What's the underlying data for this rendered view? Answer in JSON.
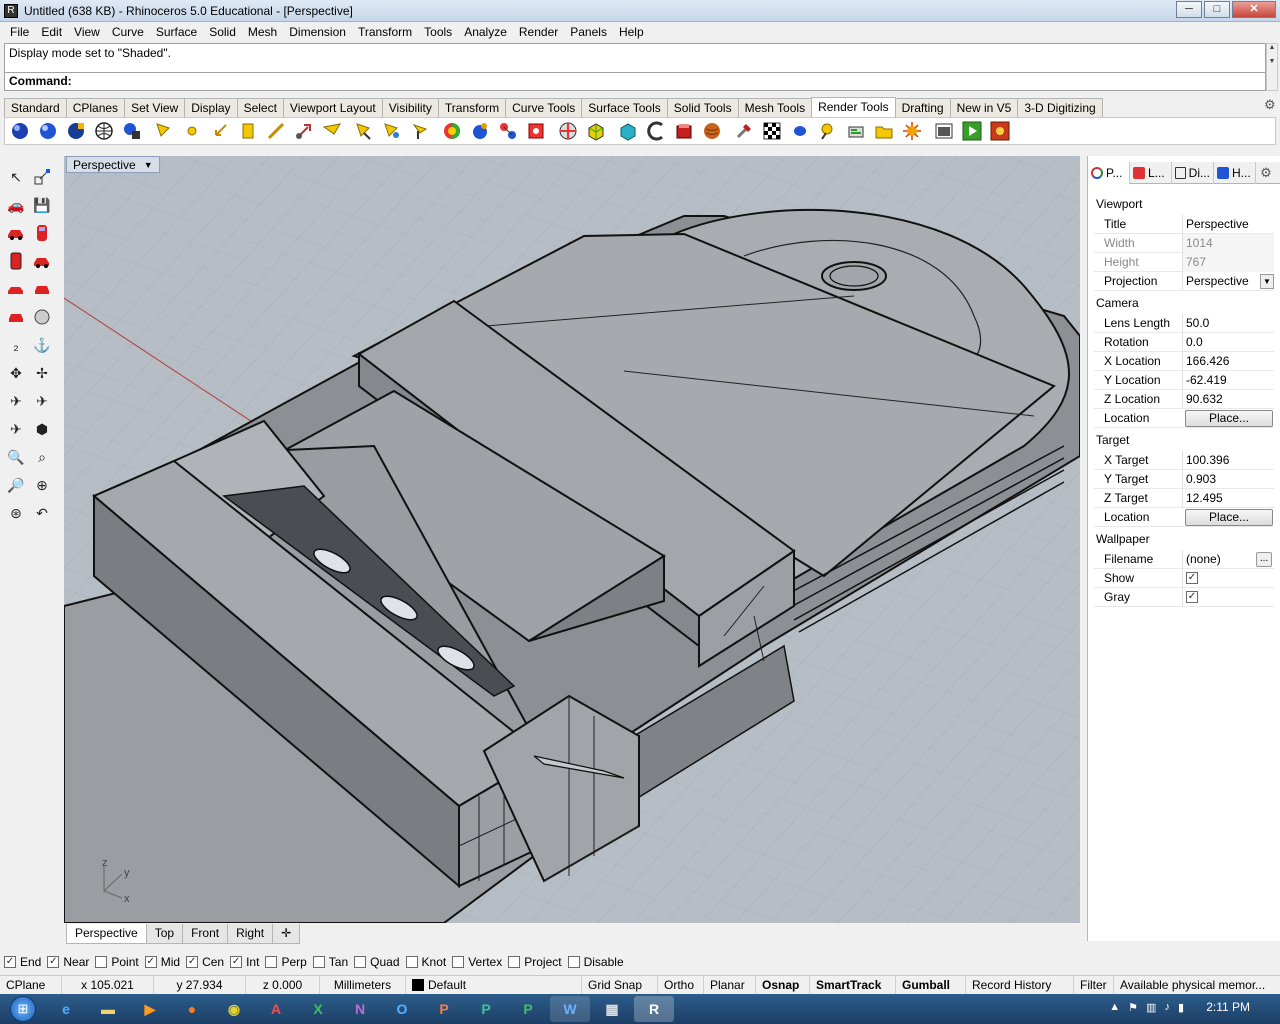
{
  "window": {
    "title": "Untitled (638 KB) - Rhinoceros 5.0 Educational - [Perspective]",
    "minimize": "─",
    "maximize": "□",
    "close": "✕"
  },
  "menu": [
    "File",
    "Edit",
    "View",
    "Curve",
    "Surface",
    "Solid",
    "Mesh",
    "Dimension",
    "Transform",
    "Tools",
    "Analyze",
    "Render",
    "Panels",
    "Help"
  ],
  "command": {
    "history": "Display mode set to \"Shaded\".",
    "prompt": "Command:"
  },
  "toolbar_tabs": [
    "Standard",
    "CPlanes",
    "Set View",
    "Display",
    "Select",
    "Viewport Layout",
    "Visibility",
    "Transform",
    "Curve Tools",
    "Surface Tools",
    "Solid Tools",
    "Mesh Tools",
    "Render Tools",
    "Drafting",
    "New in V5",
    "3-D Digitizing"
  ],
  "toolbar_active_tab": "Render Tools",
  "toolbar_icons": [
    "render-sphere-icon",
    "render-preview-icon",
    "render-blue-icon",
    "render-mesh-icon",
    "render-settings-icon",
    "spotlight-icon",
    "point-light-icon",
    "directional-light-icon",
    "rectangular-light-icon",
    "linear-light-icon",
    "light-array-icon",
    "sun-icon",
    "light-edit-icon",
    "light-target-icon",
    "material-editor-icon",
    "material-assign-icon",
    "texture-icon",
    "texture-apply-icon",
    "environment-icon",
    "ground-plane-icon",
    "decal-icon",
    "mapping-icon",
    "sphere-map-icon",
    "box-map-icon",
    "wood-texture-icon",
    "checker-icon",
    "dot-icon",
    "matchtool-icon",
    "snapshot-icon",
    "folder-icon",
    "sun-settings-icon",
    "render-window-icon",
    "play-icon",
    "record-icon"
  ],
  "viewport": {
    "title": "Perspective",
    "tabs": [
      "Perspective",
      "Top",
      "Front",
      "Right"
    ],
    "active_tab": "Perspective",
    "axis_z": "z",
    "axis_y": "y",
    "axis_x": "x"
  },
  "panel": {
    "tabs": [
      "P...",
      "L...",
      "Di...",
      "H..."
    ],
    "sections": {
      "viewport": "Viewport",
      "camera": "Camera",
      "target": "Target",
      "wallpaper": "Wallpaper"
    },
    "rows": {
      "title": {
        "label": "Title",
        "value": "Perspective"
      },
      "width": {
        "label": "Width",
        "value": "1014"
      },
      "height": {
        "label": "Height",
        "value": "767"
      },
      "projection": {
        "label": "Projection",
        "value": "Perspective"
      },
      "lens_length": {
        "label": "Lens Length",
        "value": "50.0"
      },
      "rotation": {
        "label": "Rotation",
        "value": "0.0"
      },
      "x_location": {
        "label": "X Location",
        "value": "166.426"
      },
      "y_location": {
        "label": "Y Location",
        "value": "-62.419"
      },
      "z_location": {
        "label": "Z Location",
        "value": "90.632"
      },
      "cam_location": {
        "label": "Location",
        "button": "Place..."
      },
      "x_target": {
        "label": "X Target",
        "value": "100.396"
      },
      "y_target": {
        "label": "Y Target",
        "value": "0.903"
      },
      "z_target": {
        "label": "Z Target",
        "value": "12.495"
      },
      "tgt_location": {
        "label": "Location",
        "button": "Place..."
      },
      "filename": {
        "label": "Filename",
        "value": "(none)",
        "button": "..."
      },
      "show": {
        "label": "Show",
        "checked": true
      },
      "gray": {
        "label": "Gray",
        "checked": true
      }
    }
  },
  "osnaps": [
    {
      "label": "End",
      "checked": true
    },
    {
      "label": "Near",
      "checked": true
    },
    {
      "label": "Point",
      "checked": false
    },
    {
      "label": "Mid",
      "checked": true
    },
    {
      "label": "Cen",
      "checked": true
    },
    {
      "label": "Int",
      "checked": true
    },
    {
      "label": "Perp",
      "checked": false
    },
    {
      "label": "Tan",
      "checked": false
    },
    {
      "label": "Quad",
      "checked": false
    },
    {
      "label": "Knot",
      "checked": false
    },
    {
      "label": "Vertex",
      "checked": false
    },
    {
      "label": "Project",
      "checked": false
    },
    {
      "label": "Disable",
      "checked": false
    }
  ],
  "status": {
    "cplane": "CPlane",
    "x": "x 105.021",
    "y": "y 27.934",
    "z": "z 0.000",
    "units": "Millimeters",
    "layer": "Default",
    "grid_snap": "Grid Snap",
    "ortho": "Ortho",
    "planar": "Planar",
    "osnap": "Osnap",
    "smarttrack": "SmartTrack",
    "gumball": "Gumball",
    "record_history": "Record History",
    "filter": "Filter",
    "memory": "Available physical memor..."
  },
  "taskbar": {
    "clock": "2:11 PM",
    "apps": [
      "ie-icon",
      "explorer-icon",
      "media-icon",
      "firefox-icon",
      "chrome-icon",
      "excel-icon",
      "onenote-icon",
      "outlook-icon",
      "powerpoint-icon",
      "publisher-icon",
      "project-icon",
      "word-icon",
      "calculator-icon",
      "rhino-icon"
    ]
  },
  "colors": {
    "accent": "#3a6ea5",
    "active_tab_bg": "#ffffff",
    "viewport_bg": "#b7bdc4",
    "model_face": "#8a8d91",
    "model_top": "#a3a6aa"
  }
}
